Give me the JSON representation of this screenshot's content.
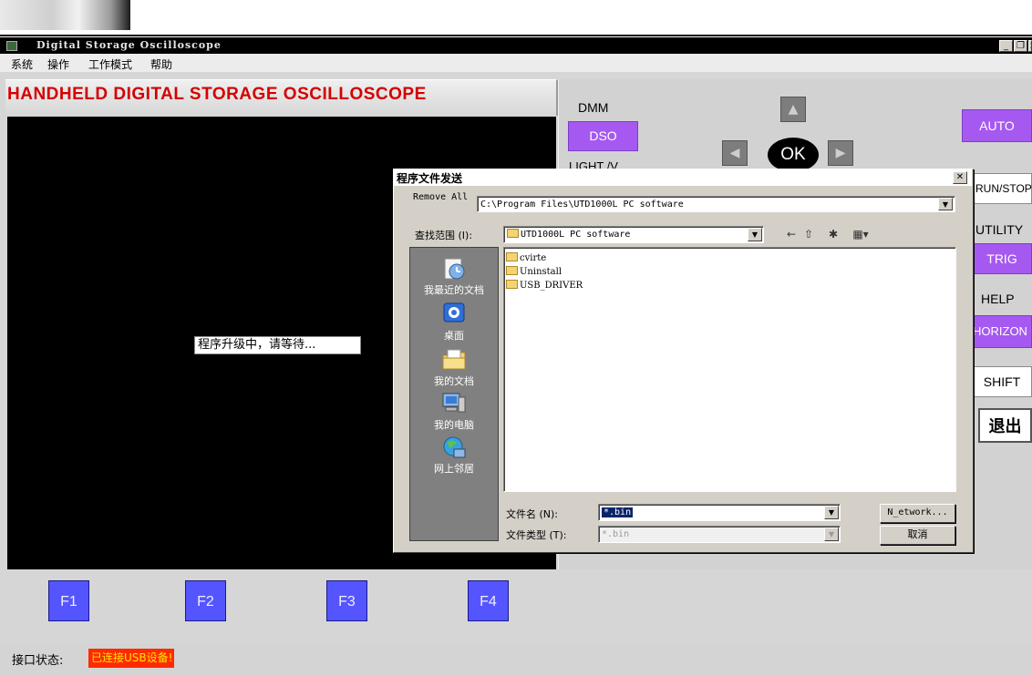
{
  "window": {
    "title": "Digital Storage Oscilloscope",
    "controls": [
      "_",
      "❐",
      "×"
    ]
  },
  "menu": [
    "系统",
    "操作",
    "工作模式",
    "帮助"
  ],
  "header": {
    "title": "HANDHELD DIGITAL STORAGE OSCILLOSCOPE"
  },
  "screen": {
    "message": "程序升级中，请等待..."
  },
  "function_keys": [
    "F1",
    "F2",
    "F3",
    "F4"
  ],
  "panel": {
    "dmm_label": "DMM",
    "dso_button": "DSO",
    "light_label": "LIGHT /V",
    "ok_button": "OK",
    "auto_button": "AUTO",
    "runstop_button": "RUN/STOP",
    "utility_label": "UTILITY",
    "trig_button": "TRIG",
    "help_label": "HELP",
    "horizon_button": "HORIZON",
    "shift_button": "SHIFT",
    "exit_button": "退出"
  },
  "dialog": {
    "title": "程序文件发送",
    "remove_all_label": "Remove All",
    "path_value": "C:\\Program Files\\UTD1000L PC software",
    "look_in_label": "查找范围 (I):",
    "look_in_value": "UTD1000L PC software",
    "places": [
      "我最近的文档",
      "桌面",
      "我的文档",
      "我的电脑",
      "网上邻居"
    ],
    "files": [
      "cvirte",
      "Uninstall",
      "USB_DRIVER"
    ],
    "filename_label": "文件名 (N):",
    "filename_value": "*.bin",
    "filetype_label": "文件类型 (T):",
    "filetype_value": "*.bin",
    "network_button": "N_etwork...",
    "cancel_button": "取消"
  },
  "status": {
    "label": "接口状态:",
    "value": "已连接USB设备!"
  },
  "colors": {
    "screen_bg": "#000000",
    "header_text": "#d40000",
    "fkey": "#5555ff",
    "panel_purple": "#a659f0",
    "status_bg": "#ff2a00",
    "status_text": "#ffe600"
  }
}
